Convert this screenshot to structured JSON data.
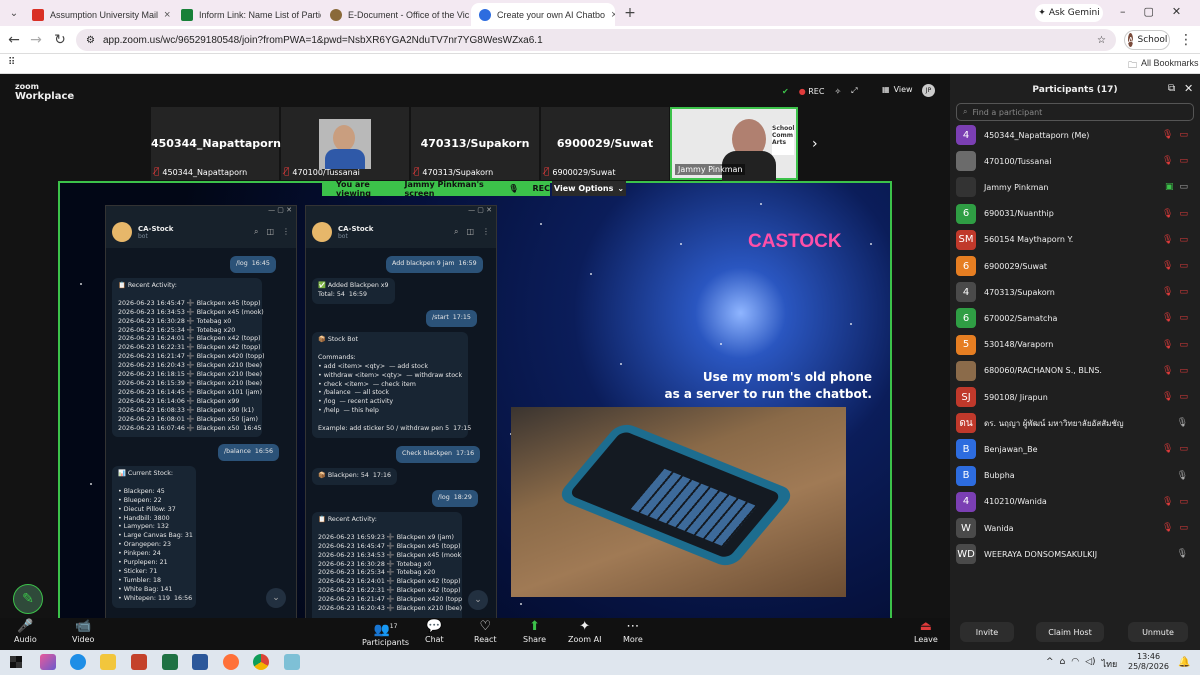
{
  "browser": {
    "tabs": [
      {
        "label": "Assumption University Mail",
        "color": "#d93025"
      },
      {
        "label": "Inform Link: Name List of Partic",
        "color": "#188038"
      },
      {
        "label": "E-Document - Office of the Vic",
        "color": "#8a6a3a"
      },
      {
        "label": "Create your own AI Chatbo",
        "color": "#2d6cdf"
      }
    ],
    "gemini": "Ask Gemini",
    "url": "app.zoom.us/wc/96529180548/join?fromPWA=1&pwd=NsbXR6YGA2NduTV7nr7YG8WesWZxa6.1",
    "profile": "School",
    "all_bookmarks": "All Bookmarks"
  },
  "zoom": {
    "brand1": "zoom",
    "brand2": "Workplace",
    "rec": "REC",
    "view": "View",
    "thumbs": [
      {
        "big": "450344_Napattaporn",
        "name": "450344_Napattaporn"
      },
      {
        "big": "",
        "name": "470100/Tussanai"
      },
      {
        "big": "470313/Supakorn",
        "name": "470313/Supakorn"
      },
      {
        "big": "6900029/Suwat",
        "name": "6900029/Suwat"
      },
      {
        "big": "",
        "name": "Jammy Pinkman"
      }
    ],
    "banner_prefix": "You are viewing",
    "banner_name": "Jammy Pinkman's screen",
    "banner_rec": "REC",
    "view_options": "View Options",
    "toolbar": [
      {
        "label": "Audio",
        "icon": "🎤"
      },
      {
        "label": "Video",
        "icon": "📹"
      },
      {
        "label": "Participants",
        "icon": "👥"
      },
      {
        "label": "Chat",
        "icon": "💬"
      },
      {
        "label": "React",
        "icon": "♡"
      },
      {
        "label": "Share",
        "icon": "⬆"
      },
      {
        "label": "Zoom AI",
        "icon": "✦"
      },
      {
        "label": "More",
        "icon": "⋯"
      },
      {
        "label": "Leave",
        "icon": "⏏"
      }
    ],
    "participants_count": "17"
  },
  "share": {
    "bot_name": "CA-Stock",
    "bot_sub": "bot",
    "title": "CASTOCK",
    "caption1": "Use my mom's old phone",
    "caption2": "as a server to run the chatbot.",
    "left_msgs": [
      "/log  16:45",
      "📋 Recent Activity:\n\n2026-06-23 16:45:47 ➕ Blackpen x45 (topp)\n2026-06-23 16:34:53 ➕ Blackpen x45 (mook)\n2026-06-23 16:30:28 ➕ Totebag x0\n2026-06-23 16:25:34 ➕ Totebag x20\n2026-06-23 16:24:01 ➕ Blackpen x42 (topp)\n2026-06-23 16:22:31 ➕ Blackpen x42 (topp)\n2026-06-23 16:21:47 ➕ Blackpen x420 (topp)\n2026-06-23 16:20:43 ➕ Blackpen x210 (bee)\n2026-06-23 16:18:15 ➕ Blackpen x210 (bee)\n2026-06-23 16:15:39 ➕ Blackpen x210 (bee)\n2026-06-23 16:14:45 ➕ Blackpen x101 (jam)\n2026-06-23 16:14:06 ➕ Blackpen x99\n2026-06-23 16:08:33 ➕ Blackpen x90 (k1)\n2026-06-23 16:08:01 ➕ Blackpen x50 (jam)\n2026-06-23 16:07:46 ➕ Blackpen x50  16:45",
      "/balance  16:56",
      "📊 Current Stock:\n\n• Blackpen: 45\n• Bluepen: 22\n• Diecut Pillow: 37\n• Handbill: 3800\n• Lamypen: 132\n• Large Canvas Bag: 31\n• Orangepen: 23\n• Pinkpen: 24\n• Purplepen: 21\n• Sticker: 71\n• Tumbler: 18\n• White Bag: 141\n• Whitepen: 119  16:56"
    ],
    "right_msgs": [
      "Add blackpen 9 jam  16:59",
      "✅ Added Blackpen x9\nTotal: 54  16:59",
      "/start  17:15",
      "📦 Stock Bot\n\nCommands:\n• add <item> <qty>  — add stock\n• withdraw <item> <qty>  — withdraw stock\n• check <item>  — check item\n• /balance  — all stock\n• /log  — recent activity\n• /help  — this help\n\nExample: add sticker 50 / withdraw pen 5  17:15",
      "Check blackpen  17:16",
      "📦 Blackpen: 54  17:16",
      "/log  18:29",
      "📋 Recent Activity:\n\n2026-06-23 16:59:23 ➕ Blackpen x9 (jam)\n2026-06-23 16:45:47 ➕ Blackpen x45 (topp)\n2026-06-23 16:34:53 ➕ Blackpen x45 (mook)\n2026-06-23 16:30:28 ➕ Totebag x0\n2026-06-23 16:25:34 ➕ Totebag x20\n2026-06-23 16:24:01 ➕ Blackpen x42 (topp)\n2026-06-23 16:22:31 ➕ Blackpen x42 (topp)\n2026-06-23 16:21:47 ➕ Blackpen x420 (topp)\n2026-06-23 16:20:43 ➕ Blackpen x210 (bee)"
    ]
  },
  "panel": {
    "title": "Participants (17)",
    "search_placeholder": "Find a participant",
    "rows": [
      {
        "av": "4",
        "c": "#7b3fb3",
        "name": "450344_Napattaporn (Me)"
      },
      {
        "av": "",
        "c": "#6b6b6b",
        "name": "470100/Tussanai"
      },
      {
        "av": "",
        "c": "#333",
        "name": "Jammy Pinkman"
      },
      {
        "av": "6",
        "c": "#2f9e44",
        "name": "690031/Nuanthip"
      },
      {
        "av": "SM",
        "c": "#c0392b",
        "name": "560154 Maythaporn Y."
      },
      {
        "av": "6",
        "c": "#e67e22",
        "name": "6900029/Suwat"
      },
      {
        "av": "4",
        "c": "#4a4a4a",
        "name": "470313/Supakorn"
      },
      {
        "av": "6",
        "c": "#2f9e44",
        "name": "670002/Samatcha"
      },
      {
        "av": "5",
        "c": "#e67e22",
        "name": "530148/Varaporn"
      },
      {
        "av": "",
        "c": "#8b6b4a",
        "name": "680060/RACHANON S., BLNS."
      },
      {
        "av": "SJ",
        "c": "#c0392b",
        "name": "590108/ Jirapun"
      },
      {
        "av": "ดน",
        "c": "#c0392b",
        "name": "ดร. นฤญา ผู้พัฒน์ มหาวิทยาลัยอัสสัมชัญ"
      },
      {
        "av": "B",
        "c": "#2d6cdf",
        "name": "Benjawan_Be"
      },
      {
        "av": "B",
        "c": "#2d6cdf",
        "name": "Bubpha"
      },
      {
        "av": "4",
        "c": "#7b3fb3",
        "name": "410210/Wanida"
      },
      {
        "av": "W",
        "c": "#4a4a4a",
        "name": "Wanida"
      },
      {
        "av": "WD",
        "c": "#4a4a4a",
        "name": "WEERAYA DONSOMSAKULKIJ"
      }
    ],
    "invite": "Invite",
    "claim": "Claim Host",
    "unmute": "Unmute"
  },
  "taskbar": {
    "time": "13:46",
    "date": "25/8/2026",
    "lang": "ไทย"
  }
}
